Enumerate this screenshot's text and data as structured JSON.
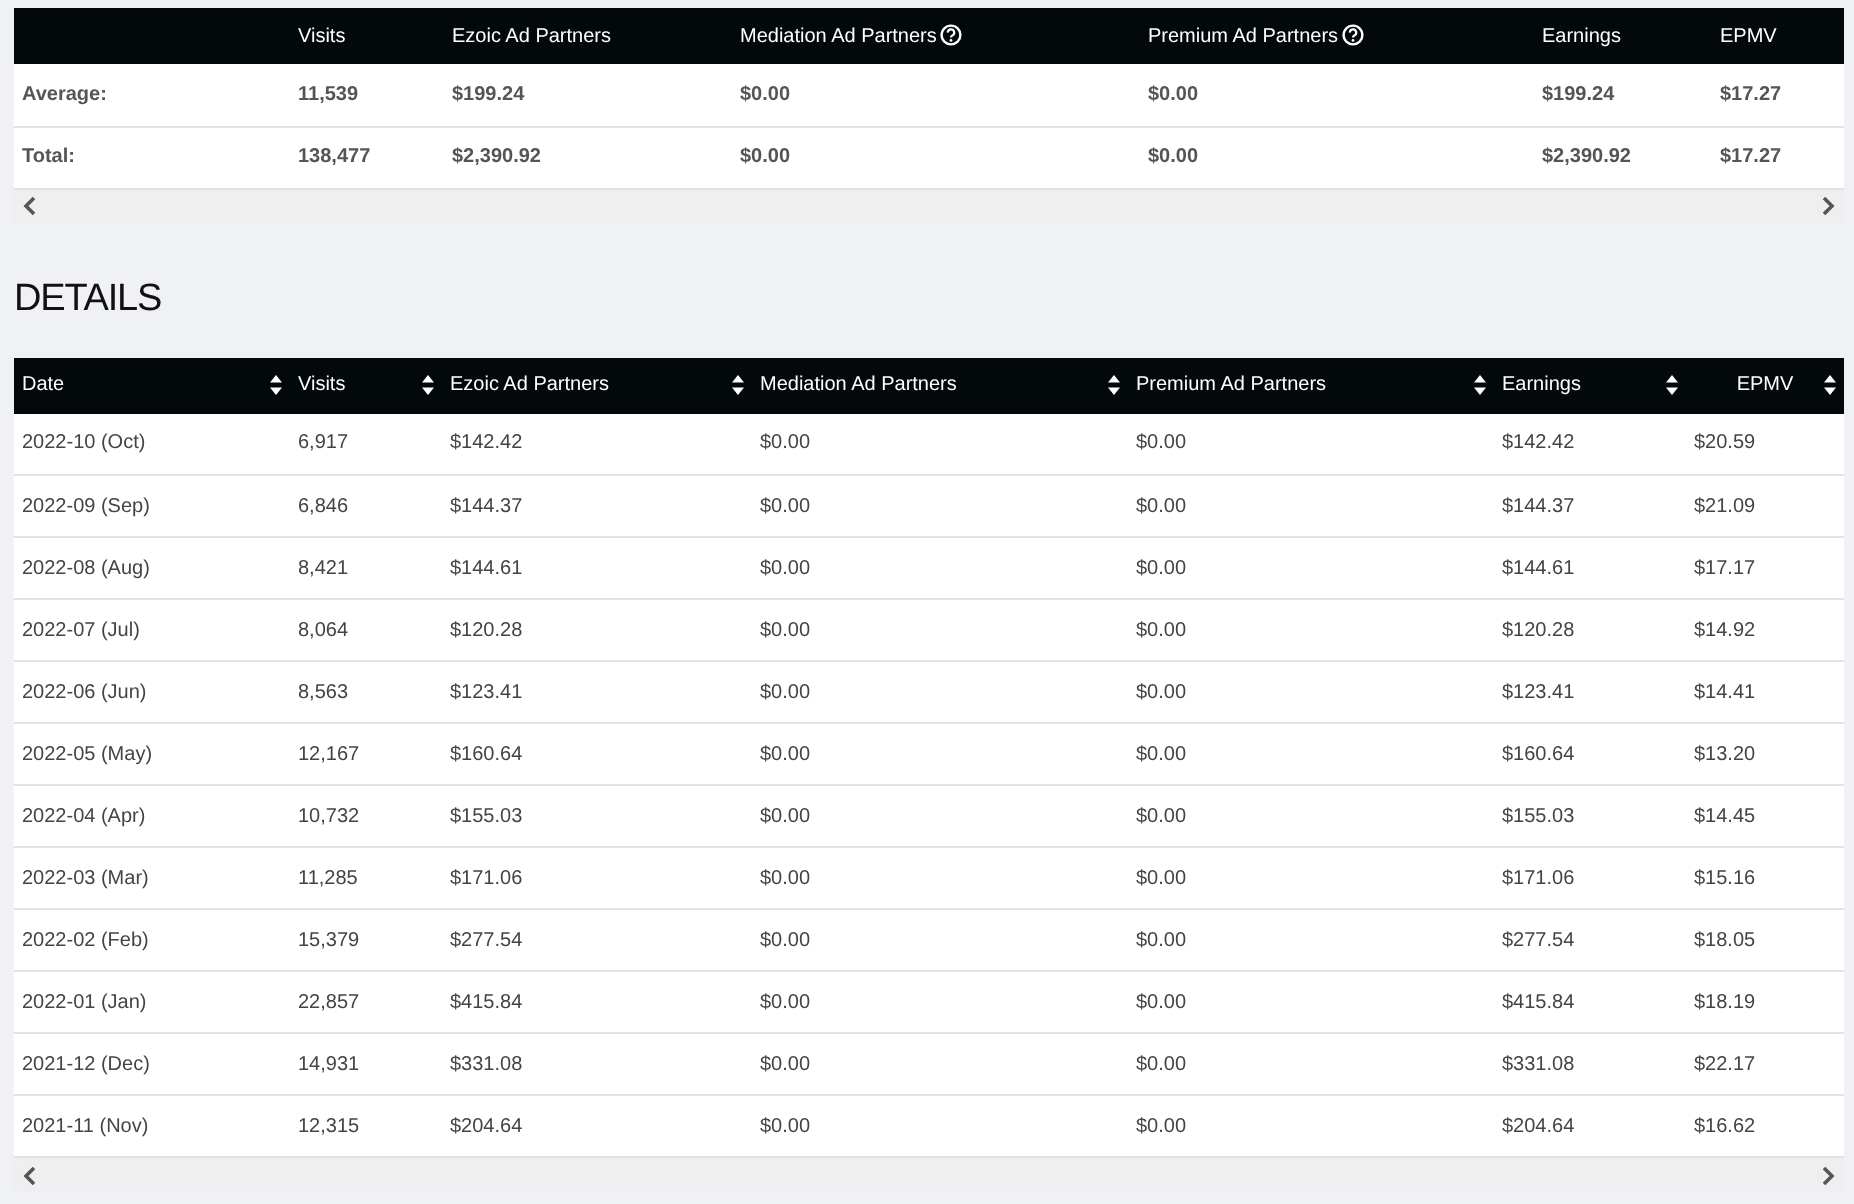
{
  "summary": {
    "columns": [
      {
        "label": "Visits",
        "help": false
      },
      {
        "label": "Ezoic Ad Partners",
        "help": false
      },
      {
        "label": "Mediation Ad Partners",
        "help": true
      },
      {
        "label": "Premium Ad Partners",
        "help": true
      },
      {
        "label": "Earnings",
        "help": false
      },
      {
        "label": "EPMV",
        "help": false
      }
    ],
    "rows": [
      {
        "label": "Average:",
        "cells": [
          "11,539",
          "$199.24",
          "$0.00",
          "$0.00",
          "$199.24",
          "$17.27"
        ]
      },
      {
        "label": "Total:",
        "cells": [
          "138,477",
          "$2,390.92",
          "$0.00",
          "$0.00",
          "$2,390.92",
          "$17.27"
        ]
      }
    ]
  },
  "details": {
    "title": "DETAILS",
    "columns": [
      {
        "label": "Date",
        "sortable": true
      },
      {
        "label": "Visits",
        "sortable": true
      },
      {
        "label": "Ezoic Ad Partners",
        "sortable": true
      },
      {
        "label": "Mediation Ad Partners",
        "sortable": true
      },
      {
        "label": "Premium Ad Partners",
        "sortable": true
      },
      {
        "label": "Earnings",
        "sortable": true
      },
      {
        "label": "EPMV",
        "sortable": true
      }
    ],
    "rows": [
      [
        "2022-10 (Oct)",
        "6,917",
        "$142.42",
        "$0.00",
        "$0.00",
        "$142.42",
        "$20.59"
      ],
      [
        "2022-09 (Sep)",
        "6,846",
        "$144.37",
        "$0.00",
        "$0.00",
        "$144.37",
        "$21.09"
      ],
      [
        "2022-08 (Aug)",
        "8,421",
        "$144.61",
        "$0.00",
        "$0.00",
        "$144.61",
        "$17.17"
      ],
      [
        "2022-07 (Jul)",
        "8,064",
        "$120.28",
        "$0.00",
        "$0.00",
        "$120.28",
        "$14.92"
      ],
      [
        "2022-06 (Jun)",
        "8,563",
        "$123.41",
        "$0.00",
        "$0.00",
        "$123.41",
        "$14.41"
      ],
      [
        "2022-05 (May)",
        "12,167",
        "$160.64",
        "$0.00",
        "$0.00",
        "$160.64",
        "$13.20"
      ],
      [
        "2022-04 (Apr)",
        "10,732",
        "$155.03",
        "$0.00",
        "$0.00",
        "$155.03",
        "$14.45"
      ],
      [
        "2022-03 (Mar)",
        "11,285",
        "$171.06",
        "$0.00",
        "$0.00",
        "$171.06",
        "$15.16"
      ],
      [
        "2022-02 (Feb)",
        "15,379",
        "$277.54",
        "$0.00",
        "$0.00",
        "$277.54",
        "$18.05"
      ],
      [
        "2022-01 (Jan)",
        "22,857",
        "$415.84",
        "$0.00",
        "$0.00",
        "$415.84",
        "$18.19"
      ],
      [
        "2021-12 (Dec)",
        "14,931",
        "$331.08",
        "$0.00",
        "$0.00",
        "$331.08",
        "$22.17"
      ],
      [
        "2021-11 (Nov)",
        "12,315",
        "$204.64",
        "$0.00",
        "$0.00",
        "$204.64",
        "$16.62"
      ]
    ]
  }
}
